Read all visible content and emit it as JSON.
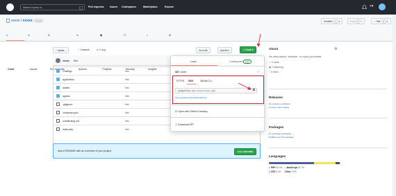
{
  "topbar": {
    "search_placeholder": "Search or jump to...",
    "nav": [
      "Pull requests",
      "Issues",
      "Codespaces",
      "Marketplace",
      "Explore"
    ]
  },
  "repo": {
    "owner": "xxxxx",
    "separator": "/",
    "name": "xxxxx",
    "visibility": "Private",
    "actions": {
      "unwatch": "Unwatch",
      "unwatch_count": "1",
      "fork": "Fork",
      "fork_count": "0",
      "star": "Star",
      "star_count": "0"
    }
  },
  "tabs": [
    "Code",
    "Issues",
    "Pull requests",
    "Actions",
    "Projects",
    "Security",
    "Insights",
    "Settings"
  ],
  "toolbar": {
    "branch": "master",
    "branches": "1 branch",
    "tags": "0 tags",
    "go_to_file": "Go to file",
    "add_file": "Add file",
    "code": "Code"
  },
  "commit": {
    "author": "xxxxx",
    "message": "first"
  },
  "files": [
    {
      "name": "ChatApp",
      "type": "folder",
      "message": "first"
    },
    {
      "name": "application",
      "type": "folder",
      "message": "first"
    },
    {
      "name": "assets",
      "type": "folder",
      "message": "first"
    },
    {
      "name": "system",
      "type": "folder",
      "message": "first"
    },
    {
      "name": ".gitignore",
      "type": "file",
      "message": "first"
    },
    {
      "name": "composer.json",
      "type": "file",
      "message": "first"
    },
    {
      "name": "contributing.md",
      "type": "file",
      "message": "first"
    },
    {
      "name": "index.php",
      "type": "file",
      "message": "first",
      "time": "2 years ago"
    }
  ],
  "readme_banner": {
    "text": "Add a README with an overview of your project.",
    "button": "Add a README"
  },
  "dropdown": {
    "tab_local": "Local",
    "tab_codespaces": "Codespaces",
    "codespaces_badge": "New",
    "clone": "Clone",
    "proto_tabs": [
      "HTTPS",
      "SSH",
      "GitHub CLI"
    ],
    "url": "git@github.com:xxxxx/xxxxx.git",
    "hint": "Use a password-protected SSH key.",
    "open_desktop": "Open with GitHub Desktop",
    "download_zip": "Download ZIP"
  },
  "about": {
    "title": "About",
    "description": "No description, website, or topics provided.",
    "stars": "0 stars",
    "watching": "1 watching",
    "forks": "0 forks"
  },
  "releases": {
    "title": "Releases",
    "line1": "No releases published",
    "line2": "Create a new release"
  },
  "packages": {
    "title": "Packages",
    "line1": "No packages published",
    "line2": "Publish your first package"
  },
  "languages": {
    "title": "Languages",
    "items": [
      {
        "name": "PHP",
        "percent": "63.0%",
        "color": "#4F5D95"
      },
      {
        "name": "JavaScript",
        "percent": "30.7%",
        "color": "#f1e05a"
      },
      {
        "name": "CSS",
        "percent": "5.4%",
        "color": "#563d7c"
      },
      {
        "name": "Other",
        "percent": "0.9%",
        "color": "#ededed"
      }
    ]
  }
}
